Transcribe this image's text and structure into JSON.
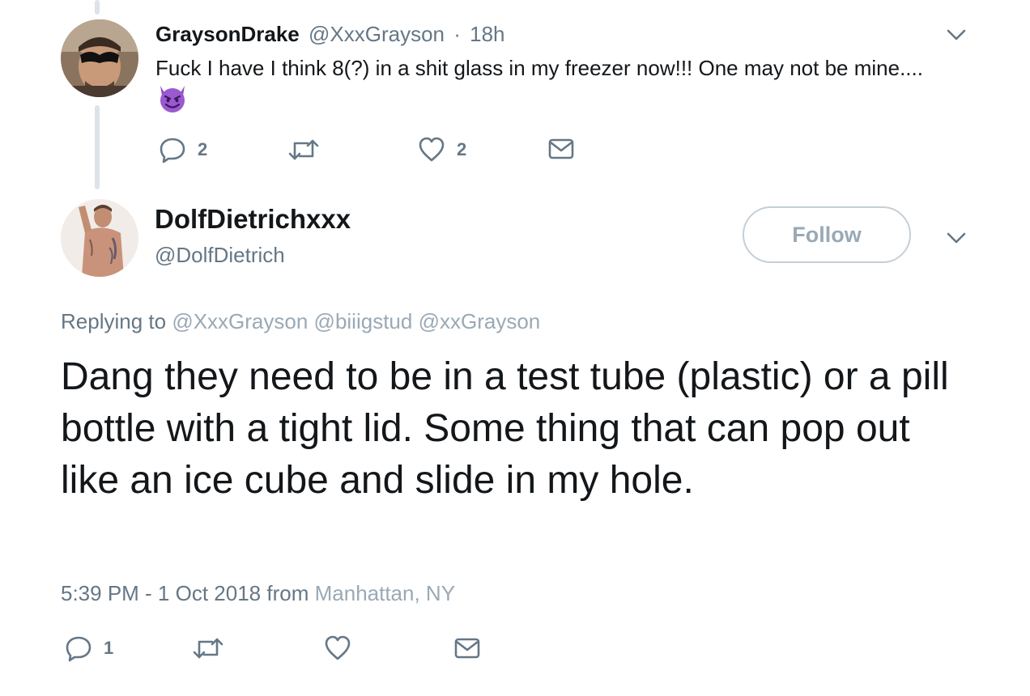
{
  "parent_tweet": {
    "display_name": "GraysonDrake",
    "handle": "@XxxGrayson",
    "separator": "·",
    "time": "18h",
    "text": "Fuck I have I think 8(?) in a shit glass in my freezer now!!! One may not be mine....",
    "actions": {
      "reply_count": "2",
      "like_count": "2"
    }
  },
  "main_tweet": {
    "display_name": "DolfDietrichxxx",
    "handle": "@DolfDietrich",
    "follow_label": "Follow",
    "replying_prefix": "Replying to",
    "replying_to": [
      "@XxxGrayson",
      "@biiigstud",
      "@xxGrayson"
    ],
    "text": "Dang they need to be in a test tube (plastic) or a pill bottle with a tight lid. Some thing that can pop out like an ice cube and slide in my hole.",
    "timestamp": "5:39 PM - 1 Oct 2018",
    "from_label": "from",
    "location": "Manhattan, NY",
    "actions": {
      "reply_count": "1"
    }
  },
  "colors": {
    "text": "#14171a",
    "muted": "#657786",
    "link_muted": "#9aa9b6",
    "thread_line": "#dde3e8",
    "emoji_purple": "#9b59d0"
  },
  "icons": [
    "avatar-grayson",
    "avatar-dolf",
    "chevron-down-icon",
    "reply-icon",
    "retweet-icon",
    "like-icon",
    "message-icon",
    "smiling-devil-emoji"
  ]
}
